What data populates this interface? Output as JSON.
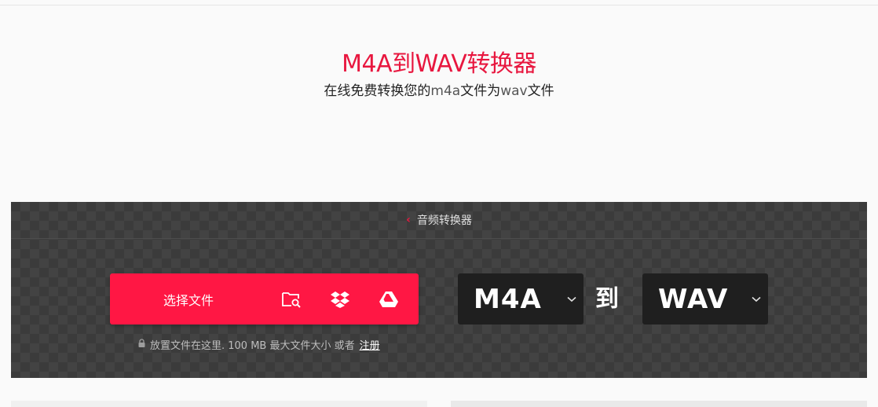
{
  "hero": {
    "title": "M4A到WAV转换器",
    "subtitle_prefix": "在线免费转换您的",
    "subtitle_from": "m4a",
    "subtitle_mid": "文件为",
    "subtitle_to": "wav",
    "subtitle_suffix": "文件"
  },
  "breadcrumb": {
    "label": "音频转换器"
  },
  "upload": {
    "button_label": "选择文件",
    "icons": [
      "folder-search-icon",
      "dropbox-icon",
      "google-drive-icon"
    ]
  },
  "drop_hint": {
    "text": "放置文件在这里. 100 MB 最大文件大小 或者",
    "signup_link": "注册"
  },
  "converter": {
    "from_format": "M4A",
    "to_label": "到",
    "to_format": "WAV"
  },
  "colors": {
    "accent": "#ff1744",
    "title": "#e8173f",
    "panel": "#3b3b3b",
    "format_box": "#1f1f1f"
  }
}
